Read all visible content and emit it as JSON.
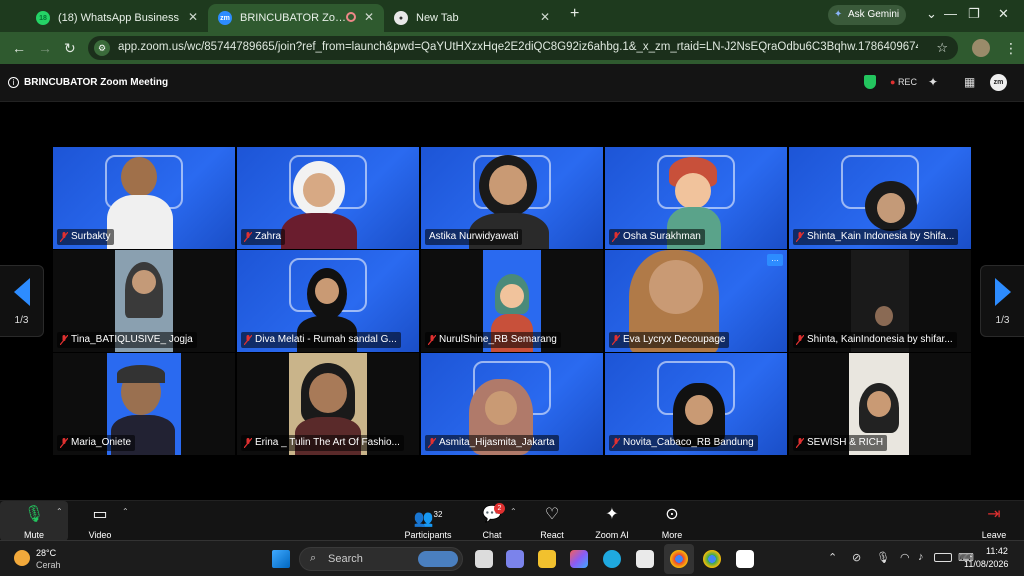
{
  "browser": {
    "tabs": [
      {
        "label": "(18) WhatsApp Business",
        "badge": "18"
      },
      {
        "label": "BRINCUBATOR Zoom Meeting"
      },
      {
        "label": "New Tab"
      }
    ],
    "new_tab": "+",
    "gemini": "Ask Gemini",
    "url": "app.zoom.us/wc/85744789665/join?ref_from=launch&pwd=QaYUtHXzxHqe2E2diQC8G92iz6ahbg.1&_x_zm_rtaid=LN-J2NsEQraOdbu6C3Bqhw.1786409674912.c9edd270e62..."
  },
  "zoom": {
    "meeting_title": "BRINCUBATOR Zoom Meeting",
    "rec": "REC",
    "app_badge": "zm",
    "page_left": "1/3",
    "page_right": "1/3",
    "participants": [
      {
        "name": "Surbakty"
      },
      {
        "name": "Zahra"
      },
      {
        "name": "Astika Nurwidyawati"
      },
      {
        "name": "Osha Surakhman"
      },
      {
        "name": "Shinta_Kain Indonesia by Shifa..."
      },
      {
        "name": "Tina_BATIQLUSIVE_ Jogja"
      },
      {
        "name": "Diva Melati - Rumah sandal G..."
      },
      {
        "name": "NurulShine_RB Semarang"
      },
      {
        "name": "Eva Lycryx Decoupage"
      },
      {
        "name": "Shinta, KainIndonesia by shifar..."
      },
      {
        "name": "Maria_Oniete"
      },
      {
        "name": "Erina _ Tulin The Art Of Fashio..."
      },
      {
        "name": "Asmita_Hijasmita_Jakarta"
      },
      {
        "name": "Novita_Cabaco_RB Bandung"
      },
      {
        "name": "SEWISH & RICH"
      }
    ],
    "toolbar": {
      "mute": "Mute",
      "video": "Video",
      "participants": "Participants",
      "participants_count": "32",
      "chat": "Chat",
      "chat_badge": "2",
      "react": "React",
      "zoom_ai": "Zoom AI",
      "more": "More",
      "leave": "Leave"
    }
  },
  "taskbar": {
    "weather_temp": "28°C",
    "weather_text": "Cerah",
    "search": "Search",
    "time": "11:42",
    "date": "11/08/2026"
  },
  "colors": {
    "zoom_blue": "#2a6af0",
    "active_speaker": "#2ecc40",
    "mic_off": "#e03030",
    "chrome_green": "#2f5a2f"
  }
}
